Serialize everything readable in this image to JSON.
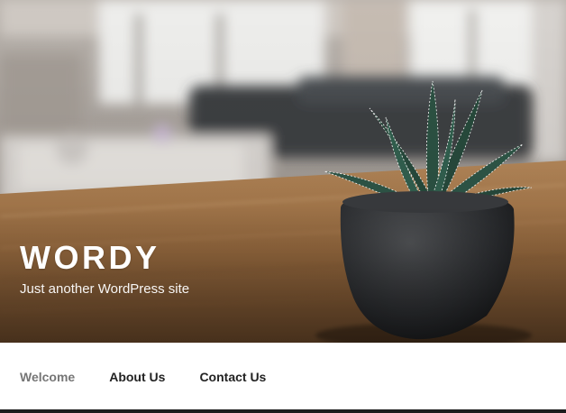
{
  "site": {
    "title": "WORDY",
    "tagline": "Just another WordPress site"
  },
  "nav": {
    "items": [
      {
        "label": "Welcome",
        "current": true
      },
      {
        "label": "About Us",
        "current": false
      },
      {
        "label": "Contact Us",
        "current": false
      }
    ]
  },
  "colors": {
    "nav_text": "#222222",
    "nav_current": "#767676",
    "title": "#ffffff"
  },
  "header_image": {
    "icon": "plant-on-table-photo"
  }
}
